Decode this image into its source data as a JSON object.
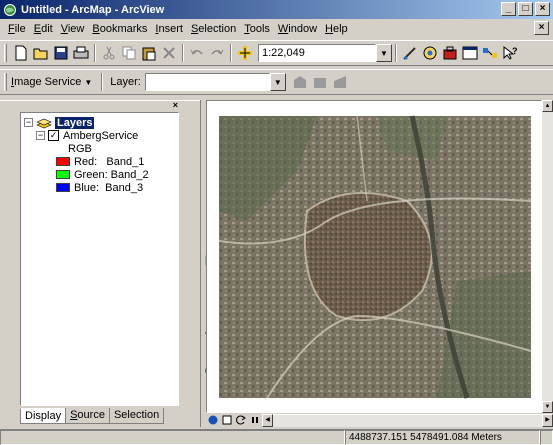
{
  "window": {
    "title": "Untitled - ArcMap - ArcView",
    "controls": [
      "_",
      "□",
      "×"
    ]
  },
  "menubar": {
    "items": [
      {
        "u": "F",
        "rest": "ile"
      },
      {
        "u": "E",
        "rest": "dit"
      },
      {
        "u": "V",
        "rest": "iew"
      },
      {
        "u": "B",
        "rest": "ookmarks"
      },
      {
        "u": "I",
        "rest": "nsert"
      },
      {
        "u": "S",
        "rest": "election"
      },
      {
        "u": "T",
        "rest": "ools"
      },
      {
        "u": "W",
        "rest": "indow"
      },
      {
        "u": "H",
        "rest": "elp"
      }
    ],
    "close_label": "×"
  },
  "standard_toolbar": {
    "scale_value": "1:22,049"
  },
  "image_service_toolbar": {
    "image_service_label_u": "I",
    "image_service_label_rest": "mage Service",
    "dropdown_arrow": "▼",
    "layer_label": "Layer:",
    "layer_value": ""
  },
  "toc": {
    "close": "×",
    "root_label": "Layers",
    "root_expander": "−",
    "service_label": "AmbergService",
    "service_expander": "−",
    "service_checked": "✓",
    "rgb_label": "RGB",
    "bands": [
      {
        "label": "Red:   Band_1",
        "color": "#ff0000"
      },
      {
        "label": "Green: Band_2",
        "color": "#00ff00"
      },
      {
        "label": "Blue:  Band_3",
        "color": "#0000ff"
      }
    ],
    "tabs": [
      {
        "u": "",
        "rest": "Display",
        "active": true
      },
      {
        "u": "S",
        "rest": "ource",
        "active": false
      },
      {
        "u": "",
        "rest": "Selection",
        "active": false
      }
    ]
  },
  "statusbar": {
    "coordinates": "4488737.151  5478491.084 Meters"
  },
  "colors": {
    "title_start": "#0a246a",
    "title_end": "#a6caf0",
    "face": "#d4d0c8"
  }
}
